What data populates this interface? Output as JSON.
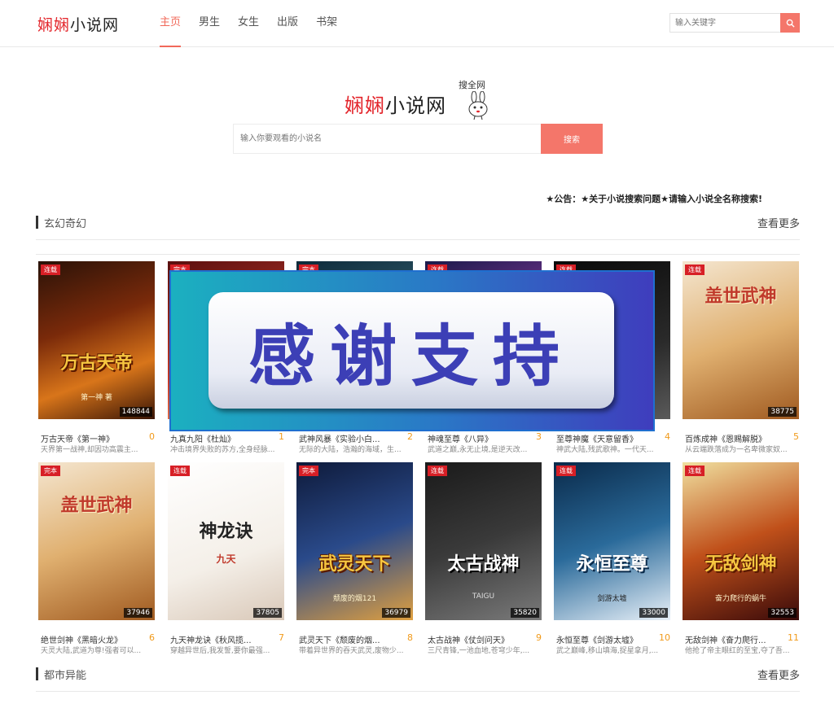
{
  "header": {
    "logo": {
      "red": "娴娴",
      "dark": "小说网"
    },
    "nav": [
      {
        "label": "主页",
        "active": true
      },
      {
        "label": "男生",
        "active": false
      },
      {
        "label": "女生",
        "active": false
      },
      {
        "label": "出版",
        "active": false
      },
      {
        "label": "书架",
        "active": false
      }
    ],
    "search_placeholder": "输入关键字",
    "search_icon": "search-icon"
  },
  "hero": {
    "logo": {
      "red": "娴娴",
      "dark": "小说网"
    },
    "tagline": "搜全网",
    "search_placeholder": "输入你要观看的小说名",
    "search_button": "搜索"
  },
  "notice": "★公告：★关于小说搜索问题★请输入小说全名称搜索!",
  "colors": {
    "accent": "#f4766a",
    "badge": "#d71f26",
    "rank": "#f19a1a"
  },
  "sections": [
    {
      "title": "玄幻奇幻",
      "more": "查看更多"
    },
    {
      "title": "都市异能",
      "more": "查看更多"
    }
  ],
  "books_row1": [
    {
      "badge": "连载",
      "count": "148844",
      "title": "万古天帝《第一神》",
      "rank": "0",
      "desc": "天界第一战神,却因功高震主...",
      "cover_title": "万古天帝",
      "cover_sub": "第一神 著"
    },
    {
      "badge": "完本",
      "count": "",
      "title": "九真九阳《杜灿》",
      "rank": "1",
      "desc": "冲击境界失败的苏方,全身经脉...",
      "cover_title": "",
      "cover_sub": ""
    },
    {
      "badge": "完本",
      "count": "",
      "title": "武神风暴《实验小白...",
      "rank": "2",
      "desc": "无际的大陆，浩瀚的海域，生...",
      "cover_title": "",
      "cover_sub": ""
    },
    {
      "badge": "连载",
      "count": "",
      "title": "神魂至尊《八异》",
      "rank": "3",
      "desc": "武道之巅,永无止境,是逆天改...",
      "cover_title": "",
      "cover_sub": ""
    },
    {
      "badge": "连载",
      "count": "",
      "title": "至尊神魔《天意留香》",
      "rank": "4",
      "desc": "神武大陆,残武歌神。一代天...",
      "cover_title": "",
      "cover_sub": ""
    },
    {
      "badge": "连载",
      "count": "38775",
      "title": "百炼成神《恩赐解脱》",
      "rank": "5",
      "desc": "从云端跌落成为一名卑微家奴...",
      "cover_title": "盖世武神",
      "cover_sub": ""
    }
  ],
  "books_row2": [
    {
      "badge": "完本",
      "count": "37946",
      "title": "绝世剑神《黑暗火龙》",
      "rank": "6",
      "desc": "天灵大陆,武道为尊!强者可以...",
      "cover_title": "盖世武神",
      "cover_sub": ""
    },
    {
      "badge": "连载",
      "count": "37805",
      "title": "九天神龙诀《秋风揽...",
      "rank": "7",
      "desc": "穿越异世后,我发誓,要你最强...",
      "cover_title": "神龙诀",
      "cover_sub": "九天"
    },
    {
      "badge": "完本",
      "count": "36979",
      "title": "武灵天下《颓废的烟...",
      "rank": "8",
      "desc": "带着异世界的吞天武灵,废物少...",
      "cover_title": "武灵天下",
      "cover_sub": "颓废的烟121"
    },
    {
      "badge": "连载",
      "count": "35820",
      "title": "太古战神《仗剑问天》",
      "rank": "9",
      "desc": "三尺青锋,一池血地,苍穹少年,...",
      "cover_title": "太古战神",
      "cover_sub": "TAIGU"
    },
    {
      "badge": "连载",
      "count": "33000",
      "title": "永恒至尊《剑游太墟》",
      "rank": "10",
      "desc": "武之巅峰,移山填海,捉星拿月,...",
      "cover_title": "永恒至尊",
      "cover_sub": "剑游太墟"
    },
    {
      "badge": "连载",
      "count": "32553",
      "title": "无敌剑神《奋力爬行...",
      "rank": "11",
      "desc": "他抢了帝主眼红的至宝,夺了吾...",
      "cover_title": "无敌剑神",
      "cover_sub": "奋力爬行的蜗牛"
    }
  ],
  "overlay": {
    "text": "感谢支持"
  }
}
